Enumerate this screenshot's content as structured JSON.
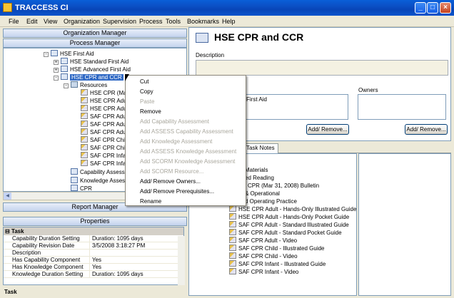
{
  "window": {
    "title": "TRACCESS CI"
  },
  "menu": [
    "File",
    "Edit",
    "View",
    "Organization",
    "Supervision",
    "Process",
    "Tools",
    "Bookmarks",
    "Help"
  ],
  "left": {
    "org_manager": "Organization Manager",
    "process_manager": "Process Manager",
    "report_manager": "Report Manager",
    "properties": "Properties",
    "tree": [
      {
        "label": "HSE  First Aid",
        "expander": "-"
      },
      {
        "label": "HSE  Standard First Aid",
        "expander": "+"
      },
      {
        "label": "HSE  Advanced First Aid",
        "expander": "+"
      },
      {
        "label": "HSE  CPR and CCR",
        "expander": "-",
        "selected": true
      },
      {
        "label": "Resources",
        "expander": "-"
      },
      {
        "label": "HSE  CPR (Mar"
      },
      {
        "label": "HSE  CPR Adu"
      },
      {
        "label": "HSE  CPR Adu"
      },
      {
        "label": "SAF  CPR Adu"
      },
      {
        "label": "SAF  CPR Adu"
      },
      {
        "label": "SAF  CPR Adu"
      },
      {
        "label": "SAF  CPR Chil"
      },
      {
        "label": "SAF  CPR Chil"
      },
      {
        "label": "SAF  CPR Infa"
      },
      {
        "label": "SAF  CPR Infa"
      },
      {
        "label": "Capability Assess"
      },
      {
        "label": "Knowledge Assess"
      },
      {
        "label": "CPR"
      }
    ],
    "props_group": "Task",
    "props": [
      {
        "k": "Capability Duration Setting",
        "v": "Duration: 1095 days"
      },
      {
        "k": "Capability Revision Date",
        "v": "3/5/2008 3:18:27 PM"
      },
      {
        "k": "Description",
        "v": ""
      },
      {
        "k": "Has Capability Component",
        "v": "Yes"
      },
      {
        "k": "Has Knowledge Component",
        "v": "Yes"
      },
      {
        "k": "Knowledge Duration Setting",
        "v": "Duration: 1095 days"
      }
    ],
    "status": "Task"
  },
  "right": {
    "title": "HSE  CPR and CCR",
    "description_label": "Description",
    "owners_label": "Owners",
    "prereq_item": "First Aid",
    "add_remove": "Add/ Remove...",
    "tab_notes": "Task Notes",
    "notes": [
      "Materials",
      "ed Reading",
      "CPR (Mar 31, 2008) Bulletin",
      "& Operational",
      "d Operating Practice",
      "HSE  CPR Adult - Hands-Only Illustrated Guide",
      "HSE  CPR Adult - Hands-Only Pocket Guide",
      "SAF  CPR Adult - Standard Illustrated Guide",
      "SAF  CPR Adult - Standard Pocket Guide",
      "SAF  CPR Adult - Video",
      "SAF  CPR Child - Illustrated Guide",
      "SAF  CPR Child - Video",
      "SAF  CPR Infant - Illustrated Guide",
      "SAF  CPR Infant - Video"
    ]
  },
  "context_menu": [
    {
      "label": "Cut",
      "enabled": true
    },
    {
      "label": "Copy",
      "enabled": true
    },
    {
      "label": "Paste",
      "enabled": false
    },
    {
      "label": "Remove",
      "enabled": true
    },
    {
      "label": "Add Capability Assessment",
      "enabled": false
    },
    {
      "label": "Add ASSESS Capability Assessment",
      "enabled": false
    },
    {
      "label": "Add Knowledge Assessment",
      "enabled": false
    },
    {
      "label": "Add ASSESS Knowledge Assessment",
      "enabled": false
    },
    {
      "label": "Add SCORM Knowledge Assessment",
      "enabled": false
    },
    {
      "label": "Add SCORM Resource...",
      "enabled": false
    },
    {
      "label": "Add/ Remove Owners...",
      "enabled": true
    },
    {
      "label": "Add/ Remove Prerequisites...",
      "enabled": true
    },
    {
      "label": "Rename",
      "enabled": true
    }
  ]
}
